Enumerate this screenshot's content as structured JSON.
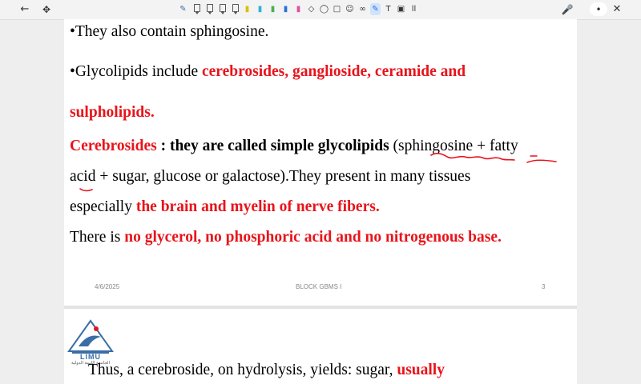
{
  "toolbar": {
    "back_icon": "back-arrow-icon",
    "grid_icon": "move-icon",
    "page_number_label": "ll"
  },
  "slide": {
    "line1": "•They also contain sphingosine.",
    "line2_prefix": "•Glycolipids include ",
    "line2_red": "cerebrosides, ganglioside, ceramide and",
    "line3_red": "sulpholipids.",
    "line4_red": "Cerebrosides",
    "line4_bold": " : they are called simple glycolipids",
    "line4_rest": " (sphingosine + fatty",
    "line5": "acid + sugar, glucose or galactose).They present in many tissues",
    "line6_prefix": "especially ",
    "line6_red": "the brain and myelin of nerve fibers.",
    "line7_prefix": " There is ",
    "line7_red": "no glycerol, no phosphoric acid and no nitrogenous base.",
    "footer_date": "4/6/2025",
    "footer_center": "BLOCK GBMS I",
    "footer_page": "3"
  },
  "slide2": {
    "logo_text": "LIMU",
    "logo_subtext": "الجامعة الليبية الدولية",
    "line1_prefix": "Thus, a cerebroside, on hydrolysis, yields: sugar,",
    "line1_red": " usually"
  },
  "colors": {
    "accent_red": "#e8141b",
    "ink_red": "#e8141b",
    "logo_blue": "#3a6ea5"
  }
}
